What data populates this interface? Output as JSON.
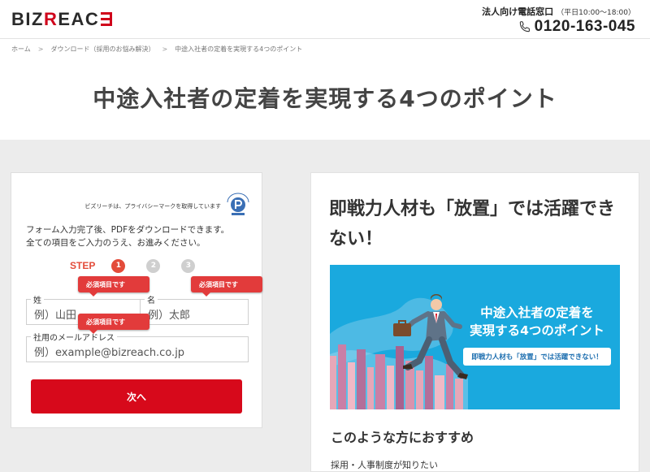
{
  "header": {
    "logo_text": "BIZREAC",
    "logo_accent": "R",
    "hotline_label": "法人向け電話窓口",
    "hotline_hours": "（平日10:00〜18:00）",
    "phone_number": "0120-163-045"
  },
  "breadcrumb": {
    "items": [
      {
        "label": "ホーム"
      },
      {
        "label": "ダウンロード（採用のお悩み解決）"
      },
      {
        "label": "中途入社者の定着を実現する4つのポイント"
      }
    ],
    "separator": ">"
  },
  "page_title": "中途入社者の定着を実現する4つのポイント",
  "form": {
    "privacy_text": "ビズリーチは、プライバシーマークを取得しています",
    "intro_line1": "フォーム入力完了後、PDFをダウンロードできます。",
    "intro_line2": "全ての項目をご入力のうえ、お進みください。",
    "step_label": "STEP",
    "steps": [
      "1",
      "2",
      "3"
    ],
    "active_step": 1,
    "fields": {
      "sei": {
        "label": "姓",
        "placeholder": "例）山田"
      },
      "mei": {
        "label": "名",
        "placeholder": "例）太郎"
      },
      "email": {
        "label": "社用のメールアドレス",
        "placeholder": "例）example@bizreach.co.jp"
      }
    },
    "required_tooltip": "必須項目です",
    "next_button": "次へ"
  },
  "info": {
    "heading": "即戦力人材も「放置」では活躍できない！",
    "banner_title_line1": "中途入社者の定着を",
    "banner_title_line2": "実現する4つのポイント",
    "banner_pill": "即戦力人材も「放置」では活躍できない！",
    "recommend_heading": "このような方におすすめ",
    "recommend_items": [
      "採用・人事制度が知りたい"
    ]
  },
  "colors": {
    "brand_red": "#d7091b",
    "step_active": "#e34c3a",
    "tooltip_red": "#e23b3b",
    "banner_blue": "#1aa9de"
  },
  "icons": {
    "phone": "phone-icon",
    "privacy_mark": "privacy-mark-icon"
  }
}
